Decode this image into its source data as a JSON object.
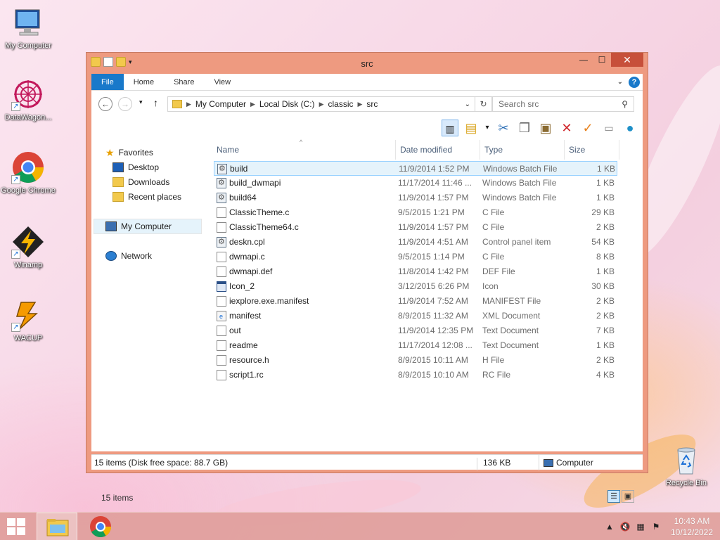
{
  "desktop": {
    "icons": [
      {
        "label": "My Computer"
      },
      {
        "label": "DataWagon..."
      },
      {
        "label": "Google Chrome"
      },
      {
        "label": "Winamp"
      },
      {
        "label": "WACUP"
      },
      {
        "label": "Recycle Bin"
      }
    ]
  },
  "window": {
    "title": "src",
    "ribbon_tabs": [
      "File",
      "Home",
      "Share",
      "View"
    ],
    "breadcrumb": [
      "My Computer",
      "Local Disk (C:)",
      "classic",
      "src"
    ],
    "search_placeholder": "Search src",
    "nav": {
      "favorites": "Favorites",
      "favorites_items": [
        "Desktop",
        "Downloads",
        "Recent places"
      ],
      "my_computer": "My Computer",
      "network": "Network"
    },
    "columns": {
      "name": "Name",
      "date": "Date modified",
      "type": "Type",
      "size": "Size"
    },
    "files": [
      {
        "name": "build",
        "date": "11/9/2014 1:52 PM",
        "type": "Windows Batch File",
        "size": "1 KB",
        "icon": "batch-file-icon",
        "selected": true
      },
      {
        "name": "build_dwmapi",
        "date": "11/17/2014 11:46 ...",
        "type": "Windows Batch File",
        "size": "1 KB",
        "icon": "batch-file-icon"
      },
      {
        "name": "build64",
        "date": "11/9/2014 1:57 PM",
        "type": "Windows Batch File",
        "size": "1 KB",
        "icon": "batch-file-icon"
      },
      {
        "name": "ClassicTheme.c",
        "date": "9/5/2015 1:21 PM",
        "type": "C File",
        "size": "29 KB",
        "icon": "file-icon"
      },
      {
        "name": "ClassicTheme64.c",
        "date": "11/9/2014 1:57 PM",
        "type": "C File",
        "size": "2 KB",
        "icon": "file-icon"
      },
      {
        "name": "deskn.cpl",
        "date": "11/9/2014 4:51 AM",
        "type": "Control panel item",
        "size": "54 KB",
        "icon": "batch-file-icon"
      },
      {
        "name": "dwmapi.c",
        "date": "9/5/2015 1:14 PM",
        "type": "C File",
        "size": "8 KB",
        "icon": "file-icon"
      },
      {
        "name": "dwmapi.def",
        "date": "11/8/2014 1:42 PM",
        "type": "DEF File",
        "size": "1 KB",
        "icon": "file-icon"
      },
      {
        "name": "Icon_2",
        "date": "3/12/2015 6:26 PM",
        "type": "Icon",
        "size": "30 KB",
        "icon": "icon-file-icon"
      },
      {
        "name": "iexplore.exe.manifest",
        "date": "11/9/2014 7:52 AM",
        "type": "MANIFEST File",
        "size": "2 KB",
        "icon": "file-icon"
      },
      {
        "name": "manifest",
        "date": "8/9/2015 11:32 AM",
        "type": "XML Document",
        "size": "2 KB",
        "icon": "xml-file-icon"
      },
      {
        "name": "out",
        "date": "11/9/2014 12:35 PM",
        "type": "Text Document",
        "size": "7 KB",
        "icon": "file-icon"
      },
      {
        "name": "readme",
        "date": "11/17/2014 12:08 ...",
        "type": "Text Document",
        "size": "1 KB",
        "icon": "file-icon"
      },
      {
        "name": "resource.h",
        "date": "8/9/2015 10:11 AM",
        "type": "H File",
        "size": "2 KB",
        "icon": "file-icon"
      },
      {
        "name": "script1.rc",
        "date": "8/9/2015 10:10 AM",
        "type": "RC File",
        "size": "4 KB",
        "icon": "file-icon"
      }
    ],
    "items_count": "15 items",
    "status": {
      "left": "15 items (Disk free space: 88.7 GB)",
      "size": "136 KB",
      "location": "Computer"
    }
  },
  "taskbar": {
    "time": "10:43 AM",
    "date": "10/12/2022"
  },
  "colors": {
    "accent": "#1979ca",
    "window_frame": "#ee9a80",
    "selection": "#e5f3fb"
  }
}
